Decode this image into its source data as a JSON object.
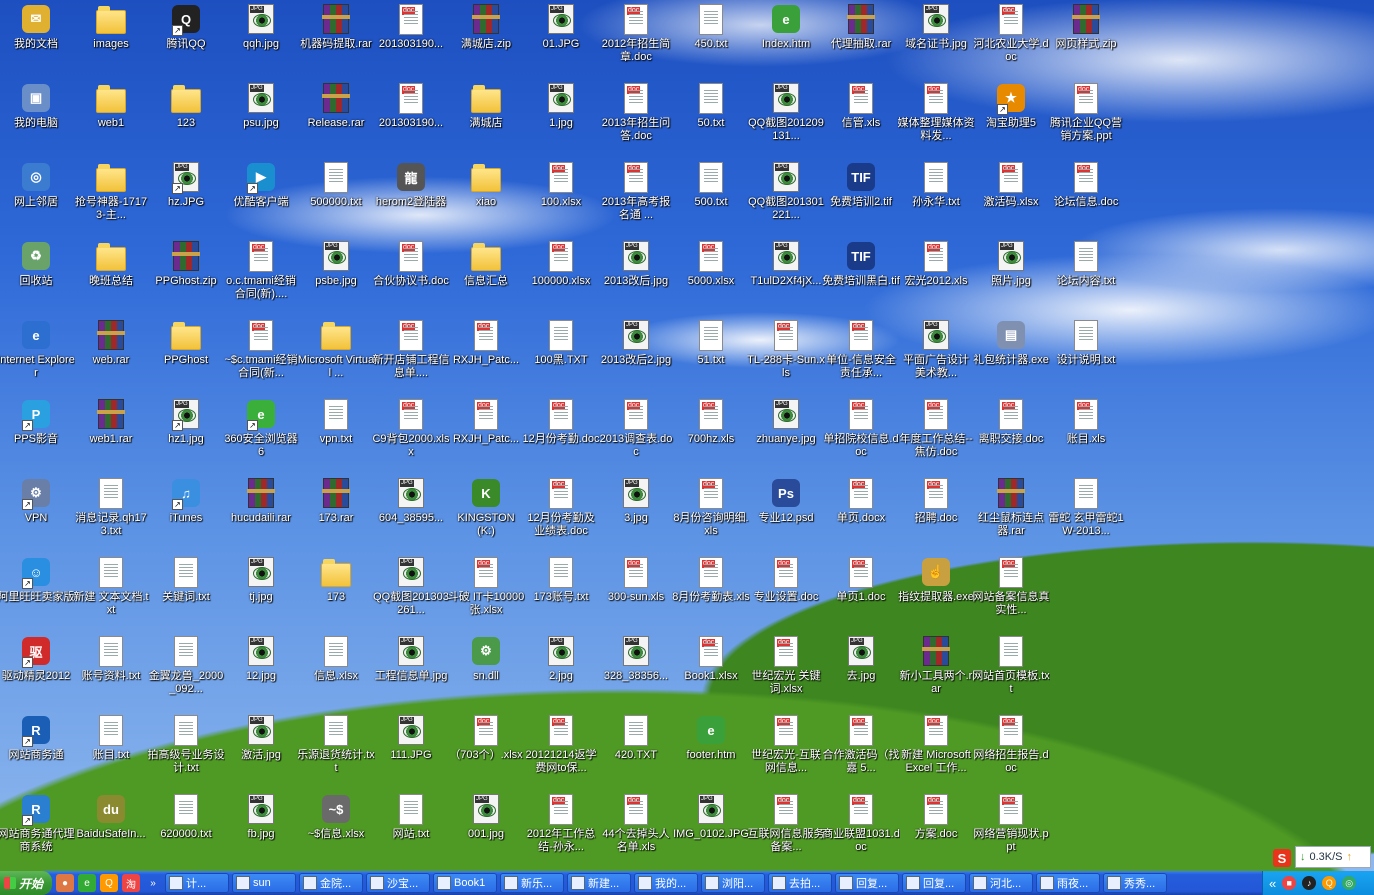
{
  "desktop": {
    "columns": [
      [
        {
          "label": "我的文档",
          "kind": "mydocs"
        },
        {
          "label": "我的电脑",
          "kind": "computer"
        },
        {
          "label": "网上邻居",
          "kind": "network"
        },
        {
          "label": "回收站",
          "kind": "recycle"
        },
        {
          "label": "Internet Explorer",
          "kind": "ie"
        },
        {
          "label": "PPS影音",
          "kind": "pps",
          "shortcut": true
        },
        {
          "label": "VPN",
          "kind": "vpn",
          "shortcut": true
        },
        {
          "label": "阿里旺旺卖家版",
          "kind": "wangwang",
          "shortcut": true
        },
        {
          "label": "驱动精灵2012",
          "kind": "driver",
          "shortcut": true
        },
        {
          "label": "网站商务通",
          "kind": "shangwutong",
          "shortcut": true
        },
        {
          "label": "网站商务通代理商系统",
          "kind": "shangwutong2",
          "shortcut": true
        }
      ],
      [
        {
          "label": "images",
          "kind": "folder"
        },
        {
          "label": "web1",
          "kind": "folder"
        },
        {
          "label": "抢号神器-17173-主...",
          "kind": "folder"
        },
        {
          "label": "晚班总结",
          "kind": "folder"
        },
        {
          "label": "web.rar",
          "kind": "rar"
        },
        {
          "label": "web1.rar",
          "kind": "rar"
        },
        {
          "label": "消息记录.qh173.txt",
          "kind": "txt"
        },
        {
          "label": "新建 文本文档.txt",
          "kind": "txt"
        },
        {
          "label": "账号资料.txt",
          "kind": "txt"
        },
        {
          "label": "账目.txt",
          "kind": "txt"
        },
        {
          "label": "BaiduSafeIn...",
          "kind": "baidu"
        }
      ],
      [
        {
          "label": "腾讯QQ",
          "kind": "qq",
          "shortcut": true
        },
        {
          "label": "123",
          "kind": "folder"
        },
        {
          "label": "hz.JPG",
          "kind": "img",
          "shortcut": true
        },
        {
          "label": "PPGhost.zip",
          "kind": "rar"
        },
        {
          "label": "PPGhost",
          "kind": "folder"
        },
        {
          "label": "hz1.jpg",
          "kind": "img",
          "shortcut": true
        },
        {
          "label": "iTunes",
          "kind": "itunes",
          "shortcut": true
        },
        {
          "label": "关键词.txt",
          "kind": "txt"
        },
        {
          "label": "金翼龙兽_2000_092...",
          "kind": "txt"
        },
        {
          "label": "拍高级号业务设计.txt",
          "kind": "txt"
        },
        {
          "label": "620000.txt",
          "kind": "txt"
        }
      ],
      [
        {
          "label": "qqh.jpg",
          "kind": "img"
        },
        {
          "label": "psu.jpg",
          "kind": "img"
        },
        {
          "label": "优酷客户端",
          "kind": "youku",
          "shortcut": true
        },
        {
          "label": "o.c.tmami经销合同(新)....",
          "kind": "doc"
        },
        {
          "label": "~$c.tmami经销合同(新...",
          "kind": "doc"
        },
        {
          "label": "360安全浏览器6",
          "kind": "360",
          "shortcut": true
        },
        {
          "label": "hucudaili.rar",
          "kind": "rar"
        },
        {
          "label": "tj.jpg",
          "kind": "img"
        },
        {
          "label": "12.jpg",
          "kind": "img"
        },
        {
          "label": "激活.jpg",
          "kind": "img"
        },
        {
          "label": "fb.jpg",
          "kind": "img"
        }
      ],
      [
        {
          "label": "机器码提取.rar",
          "kind": "rar"
        },
        {
          "label": "Release.rar",
          "kind": "rar"
        },
        {
          "label": "500000.txt",
          "kind": "txt"
        },
        {
          "label": "psbe.jpg",
          "kind": "img"
        },
        {
          "label": "Microsoft Virtual ...",
          "kind": "folder"
        },
        {
          "label": "vpn.txt",
          "kind": "txt"
        },
        {
          "label": "173.rar",
          "kind": "rar"
        },
        {
          "label": "173",
          "kind": "folder"
        },
        {
          "label": "信息.xlsx",
          "kind": "txt"
        },
        {
          "label": "乐源退货统计.txt",
          "kind": "txt"
        },
        {
          "label": "~$信息.xlsx",
          "kind": "xlsx"
        }
      ],
      [
        {
          "label": "201303190...",
          "kind": "doc"
        },
        {
          "label": "201303190...",
          "kind": "doc"
        },
        {
          "label": "herom2登陆器",
          "kind": "herom"
        },
        {
          "label": "合伙协议书.doc",
          "kind": "doc"
        },
        {
          "label": "新开店铺工程信息单....",
          "kind": "doc"
        },
        {
          "label": "C9背包2000.xlsx",
          "kind": "doc"
        },
        {
          "label": "604_38595...",
          "kind": "img"
        },
        {
          "label": "QQ截图201303261...",
          "kind": "img"
        },
        {
          "label": "工程信息单.jpg",
          "kind": "img"
        },
        {
          "label": "111.JPG",
          "kind": "img"
        },
        {
          "label": "网站.txt",
          "kind": "txt"
        }
      ],
      [
        {
          "label": "满城店.zip",
          "kind": "rar"
        },
        {
          "label": "满城店",
          "kind": "folder"
        },
        {
          "label": "xiao",
          "kind": "folder"
        },
        {
          "label": "信息汇总",
          "kind": "folder"
        },
        {
          "label": "RXJH_Patc...",
          "kind": "doc"
        },
        {
          "label": "RXJH_Patc...",
          "kind": "doc"
        },
        {
          "label": "KINGSTON (K:)",
          "kind": "kingston"
        },
        {
          "label": "斗破 IT卡10000张.xlsx",
          "kind": "doc"
        },
        {
          "label": "sn.dll",
          "kind": "dll"
        },
        {
          "label": "（703个）.xlsx",
          "kind": "doc"
        },
        {
          "label": "001.jpg",
          "kind": "img"
        }
      ],
      [
        {
          "label": "01.JPG",
          "kind": "img"
        },
        {
          "label": "1.jpg",
          "kind": "img"
        },
        {
          "label": "100.xlsx",
          "kind": "doc"
        },
        {
          "label": "100000.xlsx",
          "kind": "doc"
        },
        {
          "label": "100黑.TXT",
          "kind": "txt"
        },
        {
          "label": "12月份考勤.doc",
          "kind": "doc"
        },
        {
          "label": "12月份考勤及业绩表.doc",
          "kind": "doc"
        },
        {
          "label": "173账号.txt",
          "kind": "txt"
        },
        {
          "label": "2.jpg",
          "kind": "img"
        },
        {
          "label": "20121214返学费网to保...",
          "kind": "doc"
        },
        {
          "label": "2012年工作总结-孙永...",
          "kind": "doc"
        }
      ],
      [
        {
          "label": "2012年招生简章.doc",
          "kind": "doc"
        },
        {
          "label": "2013年招生问答.doc",
          "kind": "doc"
        },
        {
          "label": "2013年高考报名通 ...",
          "kind": "doc"
        },
        {
          "label": "2013改后.jpg",
          "kind": "img"
        },
        {
          "label": "2013改后2.jpg",
          "kind": "img"
        },
        {
          "label": "2013调查表.doc",
          "kind": "doc"
        },
        {
          "label": "3.jpg",
          "kind": "img"
        },
        {
          "label": "300-sun.xls",
          "kind": "doc"
        },
        {
          "label": "328_38356...",
          "kind": "img"
        },
        {
          "label": "420.TXT",
          "kind": "txt"
        },
        {
          "label": "44个去掉头人名单.xls",
          "kind": "doc"
        }
      ],
      [
        {
          "label": "450.txt",
          "kind": "txt"
        },
        {
          "label": "50.txt",
          "kind": "txt"
        },
        {
          "label": "500.txt",
          "kind": "txt"
        },
        {
          "label": "5000.xlsx",
          "kind": "doc"
        },
        {
          "label": "51.txt",
          "kind": "txt"
        },
        {
          "label": "700hz.xls",
          "kind": "doc"
        },
        {
          "label": "8月份咨询明细.xls",
          "kind": "doc"
        },
        {
          "label": "8月份考勤表.xls",
          "kind": "doc"
        },
        {
          "label": "Book1.xlsx",
          "kind": "doc"
        },
        {
          "label": "footer.htm",
          "kind": "htm"
        },
        {
          "label": "IMG_0102.JPG",
          "kind": "img"
        }
      ],
      [
        {
          "label": "Index.htm",
          "kind": "htm"
        },
        {
          "label": "QQ截图201209131...",
          "kind": "img"
        },
        {
          "label": "QQ截图201301221...",
          "kind": "img"
        },
        {
          "label": "T1ulD2Xf4jX...",
          "kind": "img"
        },
        {
          "label": "TL-288卡-Sun.xls",
          "kind": "doc"
        },
        {
          "label": "zhuanye.jpg",
          "kind": "img"
        },
        {
          "label": "专业12.psd",
          "kind": "psd"
        },
        {
          "label": "专业设置.doc",
          "kind": "doc"
        },
        {
          "label": "世纪宏光 关键词.xlsx",
          "kind": "doc"
        },
        {
          "label": "世纪宏光-互联网信息...",
          "kind": "doc"
        },
        {
          "label": "互联网信息服务备案...",
          "kind": "doc"
        }
      ],
      [
        {
          "label": "代理抽取.rar",
          "kind": "rar"
        },
        {
          "label": "信管.xls",
          "kind": "doc"
        },
        {
          "label": "免费培训2.tif",
          "kind": "tif"
        },
        {
          "label": "免费培训黑白.tif",
          "kind": "tif"
        },
        {
          "label": "单位-信息安全责任承...",
          "kind": "doc"
        },
        {
          "label": "单招院校信息.doc",
          "kind": "doc"
        },
        {
          "label": "单页.docx",
          "kind": "doc"
        },
        {
          "label": "单页1.doc",
          "kind": "doc"
        },
        {
          "label": "去.jpg",
          "kind": "img"
        },
        {
          "label": "合作激活码（找嘉 5...",
          "kind": "doc"
        },
        {
          "label": "商业联盟1031.doc",
          "kind": "doc"
        }
      ],
      [
        {
          "label": "域名证书.jpg",
          "kind": "img"
        },
        {
          "label": "媒体整理媒体资料发...",
          "kind": "doc"
        },
        {
          "label": "孙永华.txt",
          "kind": "txt"
        },
        {
          "label": "宏光2012.xls",
          "kind": "doc"
        },
        {
          "label": "平面广告设计 美术教...",
          "kind": "img"
        },
        {
          "label": "年度工作总结--焦仿.doc",
          "kind": "doc"
        },
        {
          "label": "招聘.doc",
          "kind": "doc"
        },
        {
          "label": "指纹提取器.exe",
          "kind": "finger"
        },
        {
          "label": "新小工具两个.rar",
          "kind": "rar"
        },
        {
          "label": "新建 Microsoft Excel 工作...",
          "kind": "doc"
        },
        {
          "label": "方案.doc",
          "kind": "doc"
        }
      ],
      [
        {
          "label": "河北农业大学.doc",
          "kind": "doc"
        },
        {
          "label": "淘宝助理5",
          "kind": "taobao",
          "shortcut": true
        },
        {
          "label": "激活码.xlsx",
          "kind": "doc"
        },
        {
          "label": "照片.jpg",
          "kind": "img"
        },
        {
          "label": "礼包统计器.exe",
          "kind": "exe"
        },
        {
          "label": "离职交接.doc",
          "kind": "doc"
        },
        {
          "label": "红尘鼠标连点器.rar",
          "kind": "rar"
        },
        {
          "label": "网站备案信息真实性...",
          "kind": "doc"
        },
        {
          "label": "网站首页模板.txt",
          "kind": "txt"
        },
        {
          "label": "网络招生报告.doc",
          "kind": "doc"
        },
        {
          "label": "网络营销现状.ppt",
          "kind": "doc"
        }
      ],
      [
        {
          "label": "网页样式.zip",
          "kind": "rar"
        },
        {
          "label": "腾讯企业QQ营销方案.ppt",
          "kind": "doc"
        },
        {
          "label": "论坛信息.doc",
          "kind": "doc"
        },
        {
          "label": "论坛内容.txt",
          "kind": "txt"
        },
        {
          "label": "设计说明.txt",
          "kind": "txt"
        },
        {
          "label": "账目.xls",
          "kind": "doc"
        },
        {
          "label": "雷蛇 玄甲雷蛇1W-2013...",
          "kind": "txt"
        }
      ]
    ]
  },
  "taskbar": {
    "start_label": "开始",
    "tasks": [
      {
        "label": "计..."
      },
      {
        "label": "sun"
      },
      {
        "label": "金院..."
      },
      {
        "label": "沙宝..."
      },
      {
        "label": "Book1"
      },
      {
        "label": "新乐..."
      },
      {
        "label": "新建..."
      },
      {
        "label": "我的..."
      },
      {
        "label": "浏阳..."
      },
      {
        "label": "去拍..."
      },
      {
        "label": "回复..."
      },
      {
        "label": "回复..."
      },
      {
        "label": "河北..."
      },
      {
        "label": "雨夜..."
      },
      {
        "label": "秀秀..."
      }
    ],
    "overflow": "«"
  },
  "netspeed": {
    "value": "0.3K/S"
  },
  "ime": {
    "label": "S"
  },
  "colors": {
    "taskbar": "#245edb",
    "start": "#3a9a34",
    "tray": "#0d8ddd",
    "sky": "#2f6ad8",
    "grass": "#4f9a24"
  }
}
